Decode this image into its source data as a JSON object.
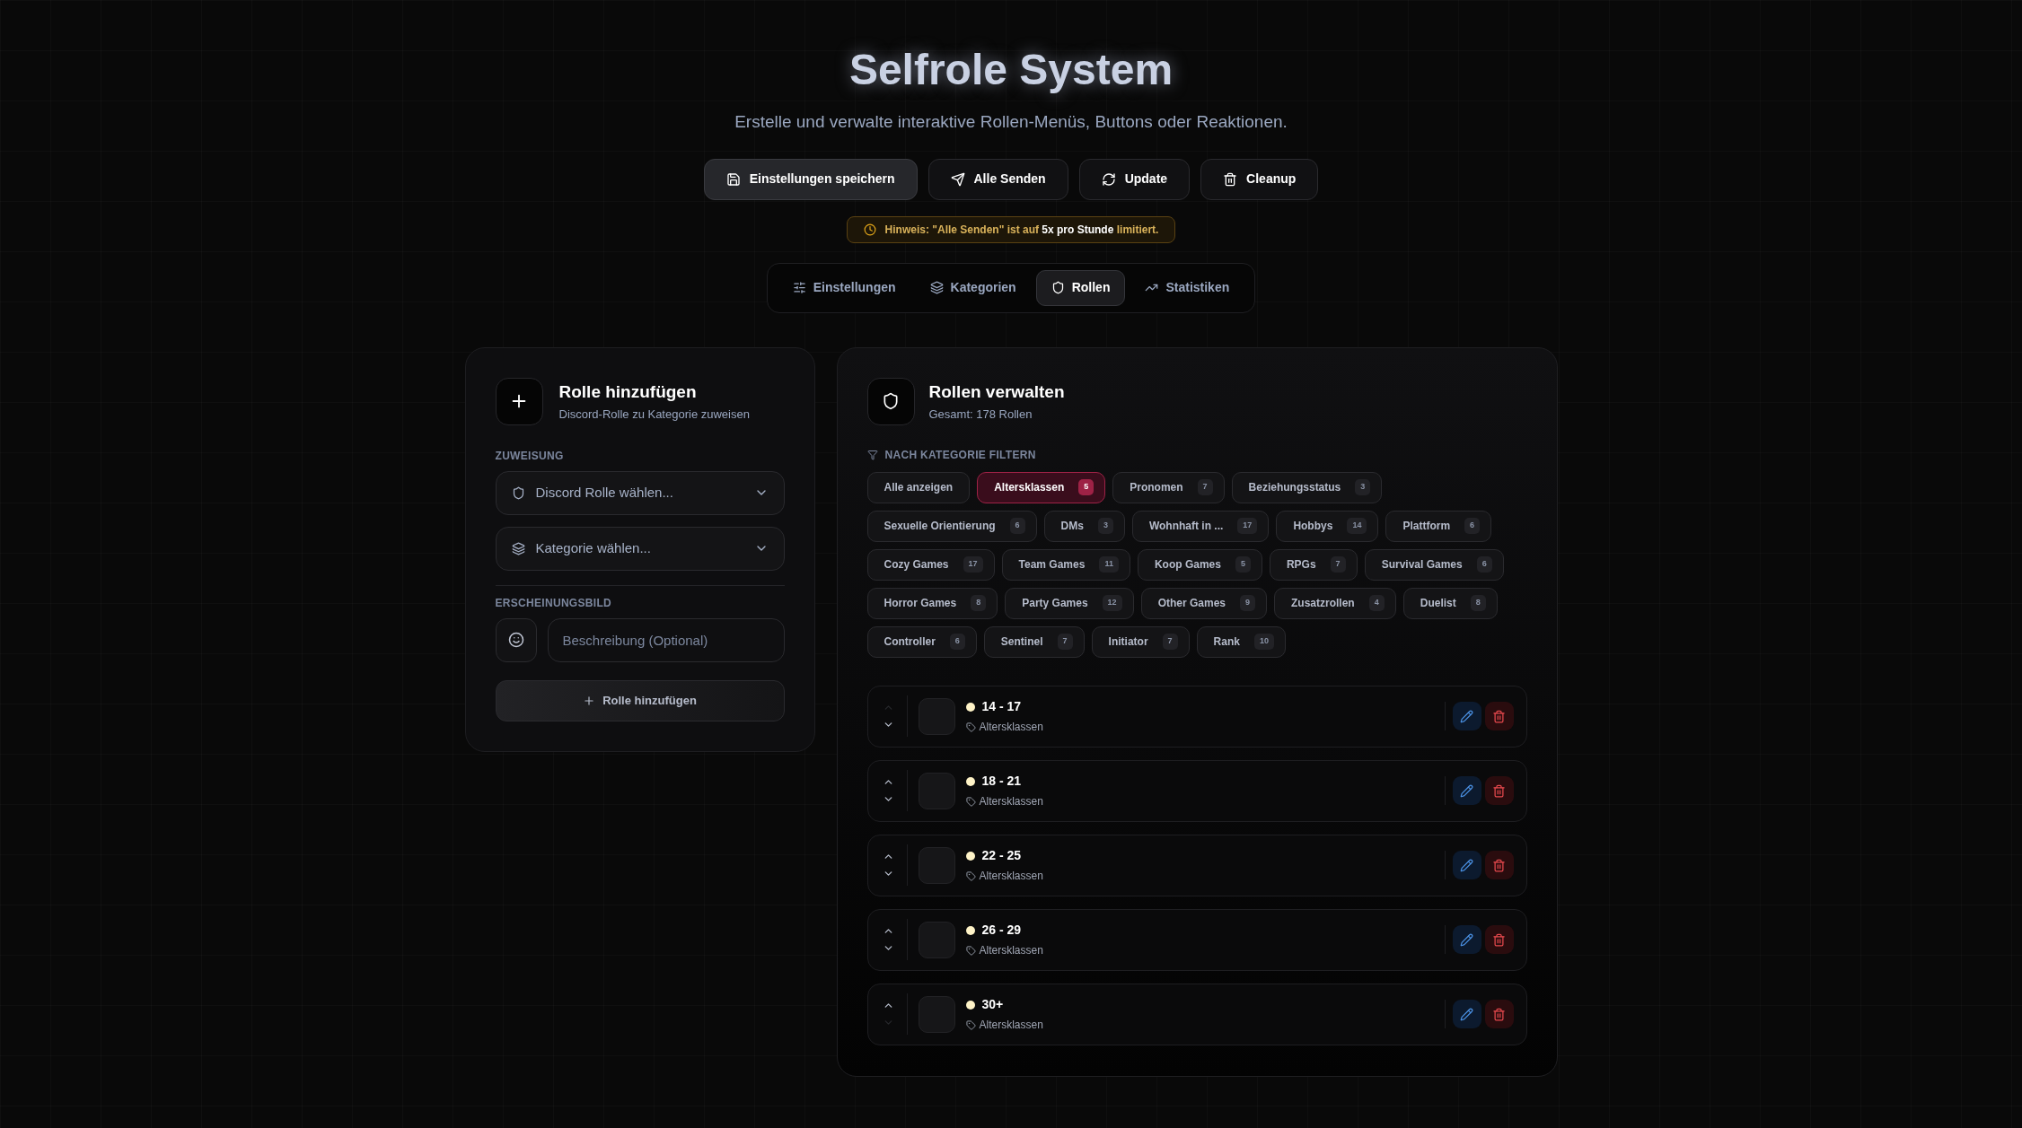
{
  "header": {
    "title": "Selfrole System",
    "subtitle": "Erstelle und verwalte interaktive Rollen-Menüs, Buttons oder Reaktionen."
  },
  "actions": [
    {
      "label": "Einstellungen speichern",
      "selected": true
    },
    {
      "label": "Alle Senden",
      "selected": false
    },
    {
      "label": "Update",
      "selected": false
    },
    {
      "label": "Cleanup",
      "selected": false
    }
  ],
  "notice": "Hinweis: \"Alle Senden\" ist auf **5x pro Stunde** limitiert.",
  "tabs": [
    {
      "label": "Einstellungen",
      "selected": false
    },
    {
      "label": "Kategorien",
      "selected": false
    },
    {
      "label": "Rollen",
      "selected": true
    },
    {
      "label": "Statistiken",
      "selected": false
    }
  ],
  "add_panel": {
    "title": "Rolle hinzufügen",
    "subtitle": "Discord-Rolle zu Kategorie zuweisen",
    "assignment_label": "ZUWEISUNG",
    "role_select": {
      "placeholder": "Discord Rolle wählen..."
    },
    "category_select": {
      "placeholder": "Kategorie wählen..."
    },
    "appearance_label": "ERSCHEINUNGSBILD",
    "description": {
      "placeholder": "Beschreibung (Optional)"
    },
    "submit": "Rolle hinzufügen"
  },
  "manage_panel": {
    "title": "Rollen verwalten",
    "subtitle": "Gesamt: 178 Rollen",
    "filter_label": "NACH KATEGORIE FILTERN",
    "filter_rows": [
      [
        {
          "label": "Alle anzeigen",
          "selected": false
        },
        {
          "label": "Altersklassen",
          "count": "5",
          "selected": true
        },
        {
          "label": "Pronomen",
          "count": "7",
          "selected": false
        },
        {
          "label": "Beziehungsstatus",
          "count": "3",
          "selected": false
        }
      ],
      [
        {
          "label": "Sexuelle Orientierung",
          "count": "6",
          "selected": false
        },
        {
          "label": "DMs",
          "count": "3",
          "selected": false
        },
        {
          "label": "Wohnhaft in ...",
          "count": "17",
          "selected": false
        },
        {
          "label": "Hobbys",
          "count": "14",
          "selected": false
        },
        {
          "label": "Plattform",
          "count": "6",
          "selected": false
        }
      ],
      [
        {
          "label": "Cozy Games",
          "count": "17",
          "selected": false
        },
        {
          "label": "Team Games",
          "count": "11",
          "selected": false
        },
        {
          "label": "Koop Games",
          "count": "5",
          "selected": false
        },
        {
          "label": "RPGs",
          "count": "7",
          "selected": false
        },
        {
          "label": "Survival Games",
          "count": "6",
          "selected": false
        }
      ],
      [
        {
          "label": "Horror Games",
          "count": "8",
          "selected": false
        },
        {
          "label": "Party Games",
          "count": "12",
          "selected": false
        },
        {
          "label": "Other Games",
          "count": "9",
          "selected": false
        },
        {
          "label": "Zusatzrollen",
          "count": "4",
          "selected": false
        },
        {
          "label": "Duelist",
          "count": "8",
          "selected": false
        }
      ],
      [
        {
          "label": "Controller",
          "count": "6",
          "selected": false
        },
        {
          "label": "Sentinel",
          "count": "7",
          "selected": false
        },
        {
          "label": "Initiator",
          "count": "7",
          "selected": false
        },
        {
          "label": "Rank",
          "count": "10",
          "selected": false
        }
      ]
    ],
    "roles": [
      {
        "name": "14 - 17",
        "category": "Altersklassen",
        "color": "#fef3c7",
        "up_disabled": true,
        "down_disabled": false
      },
      {
        "name": "18 - 21",
        "category": "Altersklassen",
        "color": "#fef3c7",
        "up_disabled": false,
        "down_disabled": false
      },
      {
        "name": "22 - 25",
        "category": "Altersklassen",
        "color": "#fef3c7",
        "up_disabled": false,
        "down_disabled": false
      },
      {
        "name": "26 - 29",
        "category": "Altersklassen",
        "color": "#fef3c7",
        "up_disabled": false,
        "down_disabled": false
      },
      {
        "name": "30+",
        "category": "Altersklassen",
        "color": "#fef3c7",
        "up_disabled": false,
        "down_disabled": true
      }
    ]
  }
}
